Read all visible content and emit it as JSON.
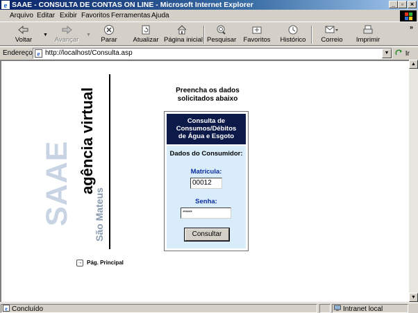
{
  "window": {
    "title": "SAAE - CONSULTA DE CONTAS ON LINE - Microsoft Internet Explorer"
  },
  "menu": {
    "items": [
      {
        "label": "Arquivo"
      },
      {
        "label": "Editar"
      },
      {
        "label": "Exibir"
      },
      {
        "label": "Favoritos"
      },
      {
        "label": "Ferramentas"
      },
      {
        "label": "Ajuda"
      }
    ]
  },
  "toolbar": {
    "back": "Voltar",
    "forward": "Avançar",
    "stop": "Parar",
    "refresh": "Atualizar",
    "home": "Página inicial",
    "search": "Pesquisar",
    "favorites": "Favoritos",
    "history": "Histórico",
    "mail": "Correio",
    "print": "Imprimir",
    "more": "»"
  },
  "address": {
    "label": "Endereço",
    "url": "http://localhost/Consulta.asp",
    "go_label": "Ir"
  },
  "logo": {
    "big": "SAAE",
    "title": "agência virtual",
    "city": "São Mateus"
  },
  "page": {
    "intro_line1": "Preencha os dados",
    "intro_line2": "solicitados abaixo",
    "form_title_1": "Consulta de",
    "form_title_2": "Consumos/Débitos",
    "form_title_3": "de Água e Esgoto",
    "section_label": "Dados do Consumidor:",
    "matricula_label": "Matrícula:",
    "matricula_value": "00012",
    "senha_label": "Senha:",
    "senha_value": "******",
    "submit_label": "Consultar",
    "home_link": "Pág. Principal"
  },
  "statusbar": {
    "status": "Concluído",
    "zone": "Intranet local"
  },
  "colors": {
    "title_bar": "#0a246a",
    "form_header": "#0c1a4a",
    "form_body": "#d9ecfa",
    "label_blue": "#0a2ca0"
  }
}
